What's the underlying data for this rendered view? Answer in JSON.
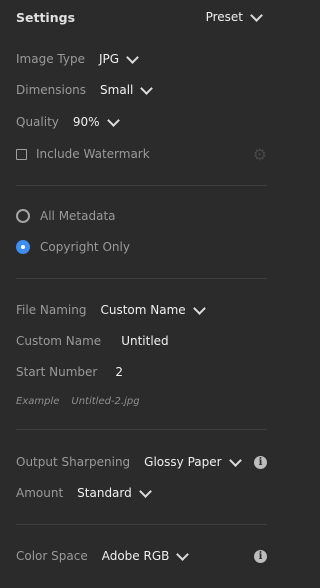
{
  "header": {
    "title": "Settings",
    "preset_label": "Preset"
  },
  "image": {
    "type_label": "Image Type",
    "type_value": "JPG",
    "dimensions_label": "Dimensions",
    "dimensions_value": "Small",
    "quality_label": "Quality",
    "quality_value": "90%",
    "watermark_label": "Include Watermark",
    "watermark_checked": false
  },
  "metadata": {
    "options": [
      {
        "label": "All Metadata",
        "selected": false
      },
      {
        "label": "Copyright Only",
        "selected": true
      }
    ]
  },
  "naming": {
    "file_naming_label": "File Naming",
    "file_naming_value": "Custom Name",
    "custom_name_label": "Custom Name",
    "custom_name_value": "Untitled",
    "start_number_label": "Start Number",
    "start_number_value": "2",
    "example_label": "Example",
    "example_value": "Untitled-2.jpg"
  },
  "sharpening": {
    "output_label": "Output Sharpening",
    "output_value": "Glossy Paper",
    "amount_label": "Amount",
    "amount_value": "Standard"
  },
  "color": {
    "space_label": "Color Space",
    "space_value": "Adobe RGB"
  },
  "icons": {
    "gear": "gear-icon",
    "info": "info-icon",
    "chevron": "chevron-down-icon"
  },
  "colors": {
    "background": "#2b2b2b",
    "accent": "#3d8ef0",
    "divider": "#3e3e3e"
  }
}
